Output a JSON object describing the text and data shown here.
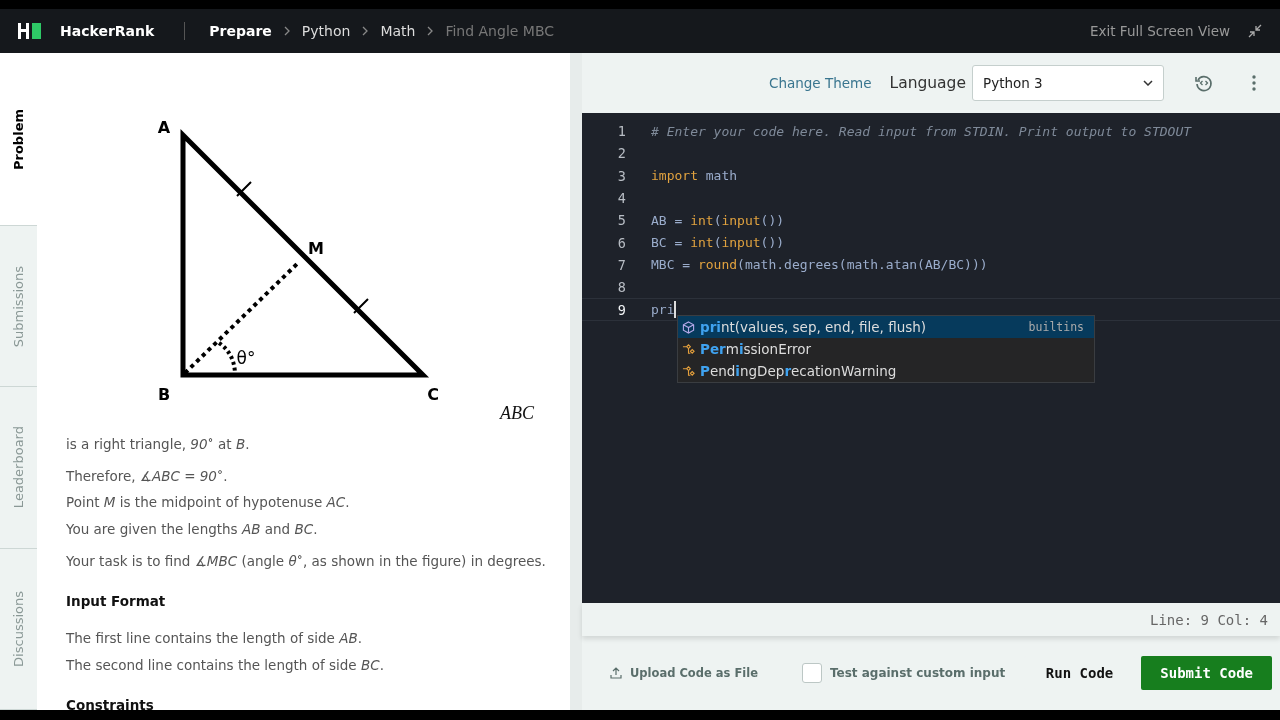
{
  "header": {
    "brand": "HackerRank",
    "breadcrumb": [
      {
        "label": "Prepare",
        "kind": "root"
      },
      {
        "label": "Python",
        "kind": "link"
      },
      {
        "label": "Math",
        "kind": "link"
      },
      {
        "label": "Find Angle MBC",
        "kind": "current"
      }
    ],
    "exit": "Exit Full Screen View"
  },
  "side_tabs": [
    {
      "label": "Problem",
      "selected": true
    },
    {
      "label": "Submissions",
      "selected": false
    },
    {
      "label": "Leaderboard",
      "selected": false
    },
    {
      "label": "Discussions",
      "selected": false
    }
  ],
  "problem": {
    "figure": {
      "labels": [
        {
          "text": "A",
          "kind": "A"
        },
        {
          "text": "M",
          "kind": "M"
        },
        {
          "text": "B",
          "kind": "B"
        },
        {
          "text": "C",
          "kind": "C"
        },
        {
          "text": "θ°",
          "kind": "theta"
        }
      ]
    },
    "title_math": "ABC",
    "paragraphs": [
      "is a right triangle, *90*$^{∘}$ at *B*.",
      "Therefore, *∡ABC = 90*$^{∘}$.",
      "Point *M* is the midpoint of hypotenuse *AC*.",
      "You are given the lengths *AB* and *BC*.",
      "Your task is to find *∡MBC* (angle *θ*$^{∘}$, as shown in the figure) in degrees."
    ],
    "sections": [
      {
        "heading": "Input Format",
        "lines": [
          "The first line contains the length of side *AB*.",
          "The second line contains the length of side *BC*."
        ]
      },
      {
        "heading": "Constraints"
      }
    ]
  },
  "editor": {
    "change_theme": "Change Theme",
    "language_label": "Language",
    "language": "Python 3",
    "lines": [
      {
        "number": "1",
        "cursor": false,
        "tokens": [
          {
            "t": "# Enter your code here. Read input from STDIN. Print output to STDOUT",
            "kind": "comment"
          }
        ]
      },
      {
        "number": "2",
        "cursor": false
      },
      {
        "number": "3",
        "cursor": false,
        "tokens": [
          {
            "t": "import",
            "kind": "keyword"
          },
          {
            "t": " math",
            "kind": "name"
          }
        ]
      },
      {
        "number": "4",
        "cursor": false
      },
      {
        "number": "5",
        "cursor": false,
        "tokens": [
          {
            "t": "AB = ",
            "kind": "name"
          },
          {
            "t": "int",
            "kind": "builtin"
          },
          {
            "t": "(",
            "kind": "name"
          },
          {
            "t": "input",
            "kind": "builtin"
          },
          {
            "t": "())",
            "kind": "name"
          }
        ]
      },
      {
        "number": "6",
        "cursor": false,
        "tokens": [
          {
            "t": "BC = ",
            "kind": "name"
          },
          {
            "t": "int",
            "kind": "builtin"
          },
          {
            "t": "(",
            "kind": "name"
          },
          {
            "t": "input",
            "kind": "builtin"
          },
          {
            "t": "())",
            "kind": "name"
          }
        ]
      },
      {
        "number": "7",
        "cursor": false,
        "tokens": [
          {
            "t": "MBC = ",
            "kind": "name"
          },
          {
            "t": "round",
            "kind": "builtin"
          },
          {
            "t": "(math.degrees(math.atan(AB/BC)))",
            "kind": "name"
          }
        ]
      },
      {
        "number": "8",
        "cursor": false
      },
      {
        "number": "9",
        "cursor": true,
        "tokens": [
          {
            "t": "pri",
            "kind": "name"
          }
        ]
      }
    ],
    "suggestions": [
      {
        "kind": "method",
        "selected": true,
        "parts": [
          {
            "t": "pri",
            "match": true
          },
          {
            "t": "nt(values, sep, end, file, flush)",
            "match": false
          }
        ],
        "detail": "builtins"
      },
      {
        "kind": "class",
        "selected": false,
        "parts": [
          {
            "t": "Pe",
            "match": true
          },
          {
            "t": "r",
            "match": true
          },
          {
            "t": "m",
            "match": false
          },
          {
            "t": "i",
            "match": true
          },
          {
            "t": "ssionError",
            "match": false
          }
        ]
      },
      {
        "kind": "class",
        "selected": false,
        "parts": [
          {
            "t": "P",
            "match": true
          },
          {
            "t": "end",
            "match": false
          },
          {
            "t": "i",
            "match": true
          },
          {
            "t": "ngDep",
            "match": false
          },
          {
            "t": "r",
            "match": true
          },
          {
            "t": "ecationWarning",
            "match": false
          }
        ]
      }
    ],
    "status": "Line: 9 Col: 4",
    "upload": "Upload Code as File",
    "custom_input": {
      "label": "Test against custom input",
      "checked": false
    },
    "run": "Run Code",
    "submit": "Submit Code"
  }
}
